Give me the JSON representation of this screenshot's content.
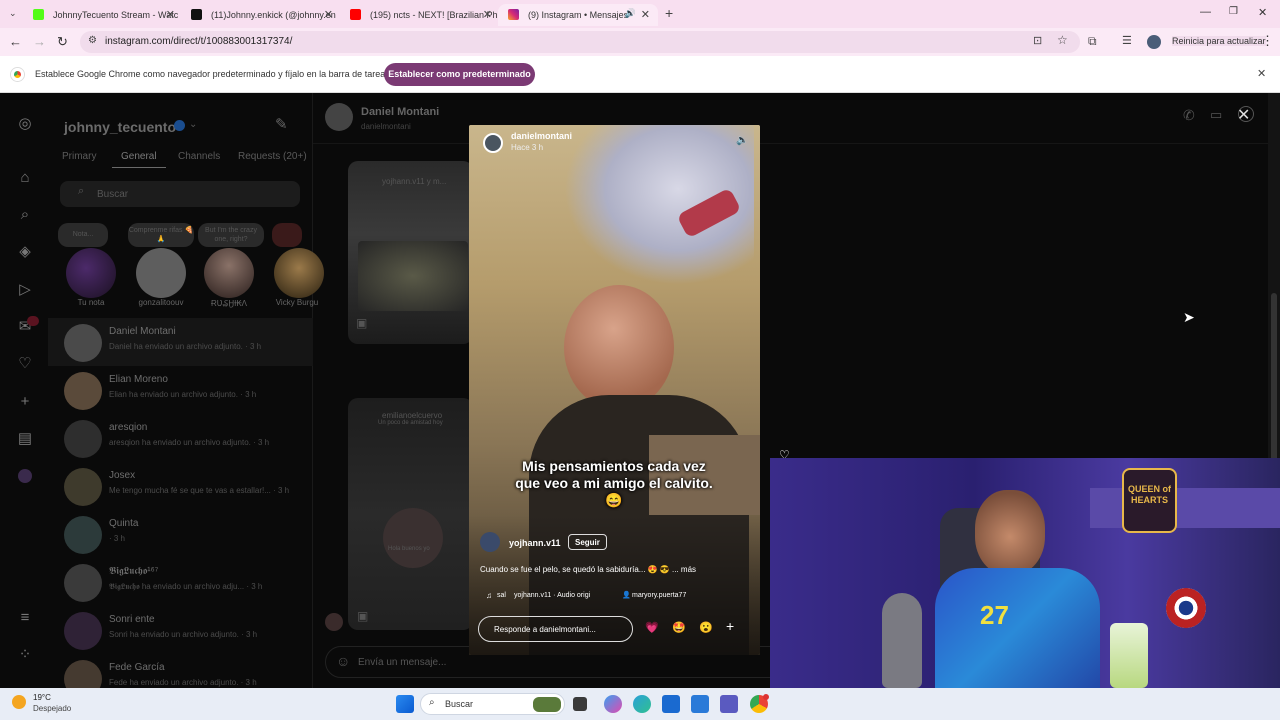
{
  "tabs": [
    {
      "label": "JohnnyTecuento Stream - Watc",
      "color": "#53fc18"
    },
    {
      "label": "(11)Johnny.enkick (@johnny.en",
      "color": "#111111"
    },
    {
      "label": "(195) ncts - NEXT! [Brazilian Ph",
      "color": "#ff0000"
    },
    {
      "label": "(9) Instagram • Mensajes",
      "color": "#d62976"
    }
  ],
  "address": {
    "url": "instagram.com/direct/t/100883001317374/",
    "update_label": "Reinicia para actualizar"
  },
  "infobar": {
    "message": "Establece Google Chrome como navegador predeterminado y fíjalo en la barra de tareas",
    "button": "Establecer como predeterminado"
  },
  "dm": {
    "username": "johnny_tecuento",
    "tabs": [
      "Primary",
      "General",
      "Channels",
      "Requests (20+)"
    ],
    "search_placeholder": "Buscar",
    "notes": [
      {
        "note": "Nota...",
        "name": "Tu nota"
      },
      {
        "note": "Comprenme rifas 🍕🙏",
        "name": "gonzalitoouv"
      },
      {
        "note": "But I'm the crazy one, right?",
        "name": "ɌƲ₷ӇƗ₭Ʌ"
      },
      {
        "note": "",
        "name": "Vicky Burgu"
      }
    ],
    "conversations": [
      {
        "name": "Daniel Montani",
        "msg": "Daniel ha enviado un archivo adjunto. · 3 h"
      },
      {
        "name": "Elian Moreno",
        "msg": "Elian ha enviado un archivo adjunto. · 3 h"
      },
      {
        "name": "aresqion",
        "msg": "aresqion ha enviado un archivo adjunto. · 3 h"
      },
      {
        "name": "Josex",
        "msg": "Me tengo mucha fé se que te vas a estallar!... · 3 h"
      },
      {
        "name": "Quinta",
        "msg": "· 3 h"
      },
      {
        "name": "𝕭𝖎𝖌𝕷𝖚𝖈𝖍𝖔¹⁶⁷",
        "msg": "𝕭𝖎𝖌𝕷𝖚𝖈𝖍𝖔 ha enviado un archivo adju... · 3 h"
      },
      {
        "name": "Sonri ente",
        "msg": "Sonri ha enviado un archivo adjunto. · 3 h"
      },
      {
        "name": "Fede García",
        "msg": "Fede ha enviado un archivo adjunto. · 3 h"
      }
    ],
    "chat_header": {
      "name": "Daniel Montani",
      "handle": "danielmontani"
    },
    "chat_items": {
      "shared1": "yojhann.v11 y m...",
      "shared2": "emilianoelcuervo",
      "tag": "Un poco de amistad hoy",
      "small": "Hola buenos yo"
    },
    "message_placeholder": "Envía un mensaje..."
  },
  "story": {
    "user": "danielmontani",
    "time": "Hace 3 h",
    "overlay_text": "Mis pensamientos cada vez que veo a mi amigo el calvito.😄",
    "author": "yojhann.v11",
    "follow": "Seguir",
    "caption": "Cuando se fue el pelo, se quedó la sabiduría... 😍 😎 ... más",
    "audio": "yojhann.v11 · Audio origi",
    "audio_prefix": "sal",
    "tagged": "maryory.puerta77",
    "reply_placeholder": "Responde a danielmontani...",
    "reactions": [
      "💗",
      "🤩",
      "😮"
    ]
  },
  "cam": {
    "jersey_number": "27",
    "sign": "QUEEN of HEARTS"
  },
  "taskbar": {
    "temp": "19°C",
    "weather": "Despejado",
    "search": "Buscar"
  }
}
